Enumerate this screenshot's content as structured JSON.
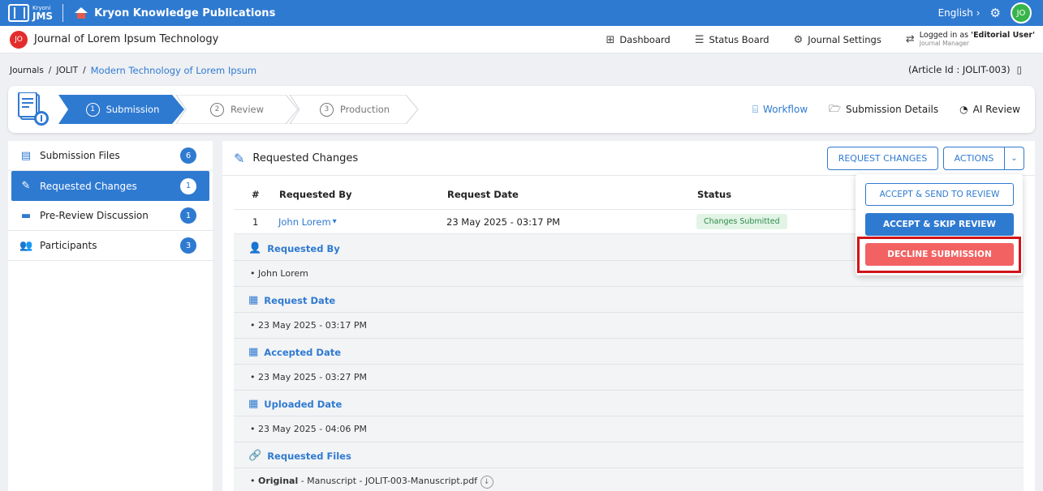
{
  "topbar": {
    "logo_small": "Kryoni",
    "logo_big": "JMS",
    "publisher": "Kryon Knowledge Publications",
    "language": "English",
    "language_chevron": "›",
    "user_initials": "JO"
  },
  "journal": {
    "badge": "JO",
    "title": "Journal of Lorem Ipsum Technology",
    "nav": {
      "dashboard": "Dashboard",
      "status_board": "Status Board",
      "journal_settings": "Journal Settings"
    },
    "logged_in_prefix": "Logged in as",
    "logged_in_user": "'Editorial User'",
    "logged_in_role": "Journal Manager"
  },
  "breadcrumb": {
    "journals": "Journals",
    "sep": "/",
    "jolit": "JOLIT",
    "article": "Modern Technology of Lorem Ipsum",
    "article_id": "(Article Id : JOLIT-003)"
  },
  "workflow": {
    "steps": [
      {
        "num": "1",
        "label": "Submission",
        "active": true
      },
      {
        "num": "2",
        "label": "Review",
        "active": false
      },
      {
        "num": "3",
        "label": "Production",
        "active": false
      }
    ],
    "links": {
      "workflow": "Workflow",
      "submission_details": "Submission Details",
      "ai_review": "AI Review"
    }
  },
  "sidebar": {
    "items": [
      {
        "label": "Submission Files",
        "count": "6",
        "icon": "file-icon"
      },
      {
        "label": "Requested Changes",
        "count": "1",
        "icon": "edit-icon"
      },
      {
        "label": "Pre-Review Discussion",
        "count": "1",
        "icon": "chat-icon"
      },
      {
        "label": "Participants",
        "count": "3",
        "icon": "users-icon"
      }
    ]
  },
  "main": {
    "title": "Requested Changes",
    "request_changes_btn": "REQUEST CHANGES",
    "actions_btn": "ACTIONS",
    "table": {
      "headers": [
        "#",
        "Requested By",
        "Request Date",
        "Status"
      ],
      "row": {
        "num": "1",
        "requested_by": "John Lorem",
        "request_date": "23 May 2025 - 03:17 PM",
        "status": "Changes Submitted"
      }
    },
    "details": {
      "requested_by_label": "Requested By",
      "requested_by_value": "John Lorem",
      "request_date_label": "Request Date",
      "request_date_value": "23 May 2025 - 03:17 PM",
      "accepted_date_label": "Accepted Date",
      "accepted_date_value": "23 May 2025 - 03:27 PM",
      "uploaded_date_label": "Uploaded Date",
      "uploaded_date_value": "23 May 2025 - 04:06 PM",
      "requested_files_label": "Requested Files",
      "file_bold": "Original",
      "file_rest": " - Manuscript - JOLIT-003-Manuscript.pdf"
    }
  },
  "actions_menu": {
    "accept_send": "ACCEPT & SEND TO REVIEW",
    "accept_skip": "ACCEPT & SKIP REVIEW",
    "decline": "DECLINE SUBMISSION"
  },
  "colors": {
    "primary": "#2f7ad1",
    "danger": "#f26262",
    "highlight": "#d0141a",
    "status_green": "#2e8b4a"
  }
}
